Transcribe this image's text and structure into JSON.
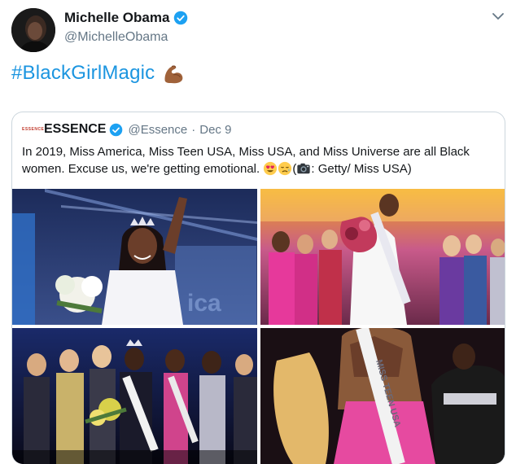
{
  "tweet": {
    "author_name": "Michelle Obama",
    "author_handle": "@MichelleObama",
    "hashtag": "#BlackGirlMagic",
    "emoji": "flexed-biceps-icon"
  },
  "quoted_tweet": {
    "logo_text": "ESSENCE",
    "author_name": "ESSENCE",
    "author_handle": "@Essence",
    "separator": "·",
    "date": "Dec 9",
    "text_part1": "In 2019, Miss America, Miss Teen USA, Miss USA, and Miss Universe are all Black women. Excuse  us, we're getting emotional. ",
    "text_part2": "(",
    "text_part3": ": Getty/ Miss USA)",
    "photos": [
      "miss-america-photo",
      "miss-teen-usa-photo",
      "miss-universe-photo",
      "miss-usa-photo"
    ]
  },
  "colors": {
    "link": "#1b95e0",
    "verified": "#1da1f2",
    "secondary_text": "#657786",
    "border": "#ccd6dd"
  }
}
